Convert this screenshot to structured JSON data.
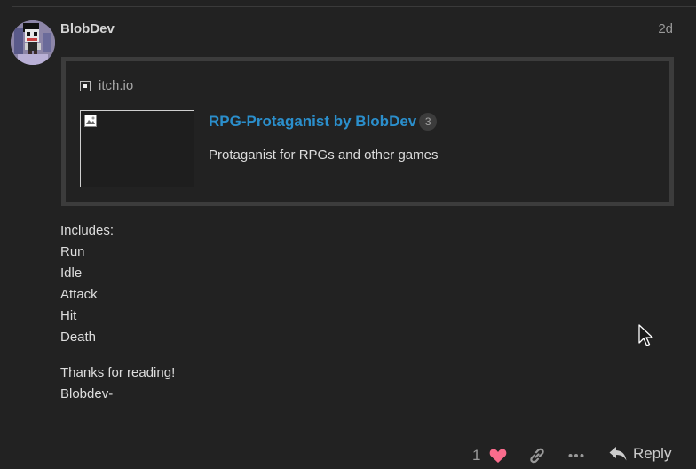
{
  "post": {
    "username": "BlobDev",
    "date": "2d",
    "avatar_icon": "pixel-character-avatar"
  },
  "onebox": {
    "source": "itch.io",
    "title": "RPG-Protaganist by BlobDev",
    "click_count": "3",
    "description": "Protaganist for RPGs and other games",
    "thumbnail_icon": "broken-image-icon"
  },
  "body": {
    "lines": [
      "Includes:",
      "Run",
      "Idle",
      "Attack",
      "Hit",
      "Death"
    ],
    "closing": [
      "Thanks for reading!",
      "Blobdev-"
    ]
  },
  "actions": {
    "like_count": "1",
    "reply_label": "Reply",
    "like_color": "#fa6c8d"
  },
  "colors": {
    "background": "#222222",
    "link": "#2b8fcc"
  }
}
